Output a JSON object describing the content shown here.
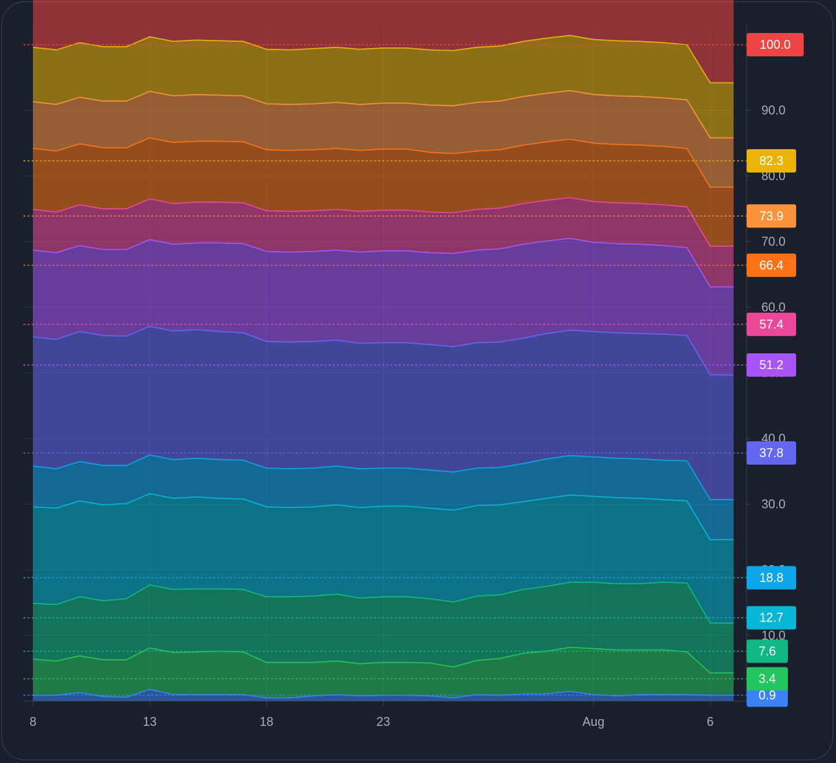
{
  "chart_data": {
    "type": "area",
    "stacked": true,
    "x_ticks": [
      "8",
      "13",
      "18",
      "23",
      "Aug",
      "6"
    ],
    "y_ticks": [
      "10.0",
      "20.0",
      "30.0",
      "40.0",
      "50.0",
      "60.0",
      "70.0",
      "80.0",
      "90.0"
    ],
    "ylim": [
      0,
      100
    ],
    "grid": true,
    "x_dates": [
      "2024-07-08",
      "2024-07-09",
      "2024-07-10",
      "2024-07-11",
      "2024-07-12",
      "2024-07-13",
      "2024-07-14",
      "2024-07-15",
      "2024-07-16",
      "2024-07-17",
      "2024-07-18",
      "2024-07-19",
      "2024-07-20",
      "2024-07-21",
      "2024-07-22",
      "2024-07-23",
      "2024-07-24",
      "2024-07-25",
      "2024-07-26",
      "2024-07-27",
      "2024-07-28",
      "2024-07-29",
      "2024-07-30",
      "2024-07-31",
      "2024-08-01",
      "2024-08-02",
      "2024-08-03",
      "2024-08-04",
      "2024-08-05",
      "2024-08-06",
      "2024-08-07"
    ],
    "series": [
      {
        "last": "0.9",
        "color": "#3b82f6",
        "values": [
          0.9,
          0.9,
          1.3,
          0.7,
          0.6,
          1.8,
          1.0,
          1.0,
          1.0,
          1.0,
          0.5,
          0.5,
          0.8,
          1.0,
          0.8,
          0.9,
          0.9,
          0.8,
          0.5,
          1.0,
          0.9,
          1.1,
          1.1,
          1.5,
          1.0,
          0.8,
          1.0,
          1.0,
          1.0,
          0.9,
          0.9
        ]
      },
      {
        "last": "3.4",
        "color": "#22c55e",
        "values": [
          5.5,
          5.2,
          5.6,
          5.6,
          5.7,
          6.3,
          6.4,
          6.5,
          6.6,
          6.5,
          5.4,
          5.4,
          5.1,
          5.1,
          4.9,
          5.0,
          5.0,
          5.0,
          4.7,
          5.2,
          5.6,
          6.2,
          6.5,
          6.7,
          7.0,
          7.0,
          6.8,
          6.8,
          6.5,
          3.4,
          3.4
        ]
      },
      {
        "last": "7.6",
        "color": "#10b981",
        "values": [
          8.5,
          8.6,
          9.0,
          9.0,
          9.3,
          9.6,
          9.6,
          9.6,
          9.5,
          9.5,
          10.0,
          10.0,
          10.1,
          10.2,
          10.0,
          10.0,
          10.0,
          9.8,
          9.9,
          9.8,
          9.7,
          9.7,
          9.9,
          9.9,
          10.1,
          10.1,
          10.1,
          10.3,
          10.5,
          7.6,
          7.6
        ]
      },
      {
        "last": "12.7",
        "color": "#06b6d4",
        "values": [
          14.7,
          14.7,
          14.6,
          14.6,
          14.5,
          13.9,
          13.9,
          14.0,
          13.8,
          13.8,
          13.7,
          13.6,
          13.6,
          13.6,
          13.8,
          13.8,
          13.8,
          13.8,
          14.0,
          13.8,
          13.7,
          13.4,
          13.4,
          13.3,
          13.1,
          13.1,
          13.0,
          12.6,
          12.5,
          12.7,
          12.7
        ]
      },
      {
        "last": "18.8",
        "color": "#0ea5e9",
        "values": [
          6.2,
          6.0,
          6.0,
          6.0,
          5.8,
          5.9,
          5.9,
          5.9,
          5.9,
          5.9,
          5.9,
          5.9,
          5.9,
          5.9,
          5.9,
          5.8,
          5.8,
          5.8,
          5.8,
          5.7,
          5.7,
          5.8,
          6.0,
          6.0,
          6.0,
          6.0,
          6.0,
          6.0,
          6.1,
          6.1,
          6.1
        ]
      },
      {
        "last": "37.8",
        "color": "#6366f1",
        "values": [
          19.7,
          19.7,
          19.8,
          19.8,
          19.7,
          19.6,
          19.6,
          19.6,
          19.5,
          19.4,
          19.3,
          19.3,
          19.3,
          19.2,
          19.1,
          19.1,
          19.1,
          19.1,
          19.1,
          19.1,
          19.1,
          19.1,
          19.1,
          19.1,
          19.1,
          19.1,
          19.1,
          19.2,
          19.1,
          19.0,
          19.0
        ]
      },
      {
        "last": "51.2",
        "color": "#a855f7",
        "values": [
          13.2,
          13.2,
          13.1,
          13.1,
          13.2,
          13.2,
          13.2,
          13.2,
          13.5,
          13.6,
          13.7,
          13.7,
          13.7,
          13.7,
          13.9,
          14.0,
          14.0,
          14.0,
          14.2,
          14.1,
          14.2,
          14.3,
          14.1,
          14.0,
          13.6,
          13.6,
          13.6,
          13.5,
          13.4,
          13.4,
          13.4
        ]
      },
      {
        "last": "57.4",
        "color": "#ec4899",
        "values": [
          6.2,
          6.2,
          6.2,
          6.2,
          6.2,
          6.2,
          6.2,
          6.2,
          6.2,
          6.2,
          6.2,
          6.2,
          6.2,
          6.2,
          6.2,
          6.2,
          6.2,
          6.2,
          6.2,
          6.2,
          6.2,
          6.2,
          6.2,
          6.2,
          6.2,
          6.2,
          6.2,
          6.2,
          6.2,
          6.2,
          6.2
        ]
      },
      {
        "last": "66.4",
        "color": "#f97316",
        "values": [
          9.3,
          9.3,
          9.3,
          9.3,
          9.3,
          9.3,
          9.3,
          9.3,
          9.3,
          9.3,
          9.3,
          9.3,
          9.3,
          9.3,
          9.3,
          9.3,
          9.3,
          9.1,
          9.0,
          8.9,
          8.9,
          8.9,
          8.9,
          8.9,
          8.9,
          8.9,
          8.9,
          8.9,
          8.9,
          9.0,
          9.0
        ]
      },
      {
        "last": "73.9",
        "color": "#fb923c",
        "values": [
          7.1,
          7.1,
          7.1,
          7.1,
          7.1,
          7.1,
          7.1,
          7.1,
          7.0,
          7.0,
          7.0,
          7.0,
          7.0,
          7.0,
          7.0,
          7.0,
          7.0,
          7.2,
          7.3,
          7.4,
          7.4,
          7.4,
          7.4,
          7.4,
          7.4,
          7.4,
          7.4,
          7.4,
          7.4,
          7.5,
          7.5
        ]
      },
      {
        "last": "82.3",
        "color": "#eab308",
        "values": [
          8.3,
          8.3,
          8.3,
          8.3,
          8.3,
          8.3,
          8.3,
          8.3,
          8.3,
          8.3,
          8.3,
          8.3,
          8.4,
          8.4,
          8.4,
          8.4,
          8.4,
          8.4,
          8.4,
          8.4,
          8.4,
          8.4,
          8.4,
          8.4,
          8.4,
          8.4,
          8.4,
          8.4,
          8.4,
          8.4,
          8.4
        ]
      },
      {
        "last": "100.0",
        "color": "#ef4444",
        "values": [
          17.7,
          17.7,
          17.7,
          17.7,
          17.7,
          17.7,
          17.7,
          17.7,
          17.7,
          17.7,
          17.7,
          17.7,
          17.7,
          17.7,
          17.7,
          17.7,
          17.7,
          17.7,
          17.7,
          17.7,
          17.7,
          17.7,
          17.7,
          17.7,
          17.7,
          17.7,
          17.7,
          17.7,
          17.7,
          17.7,
          17.7
        ]
      }
    ]
  }
}
